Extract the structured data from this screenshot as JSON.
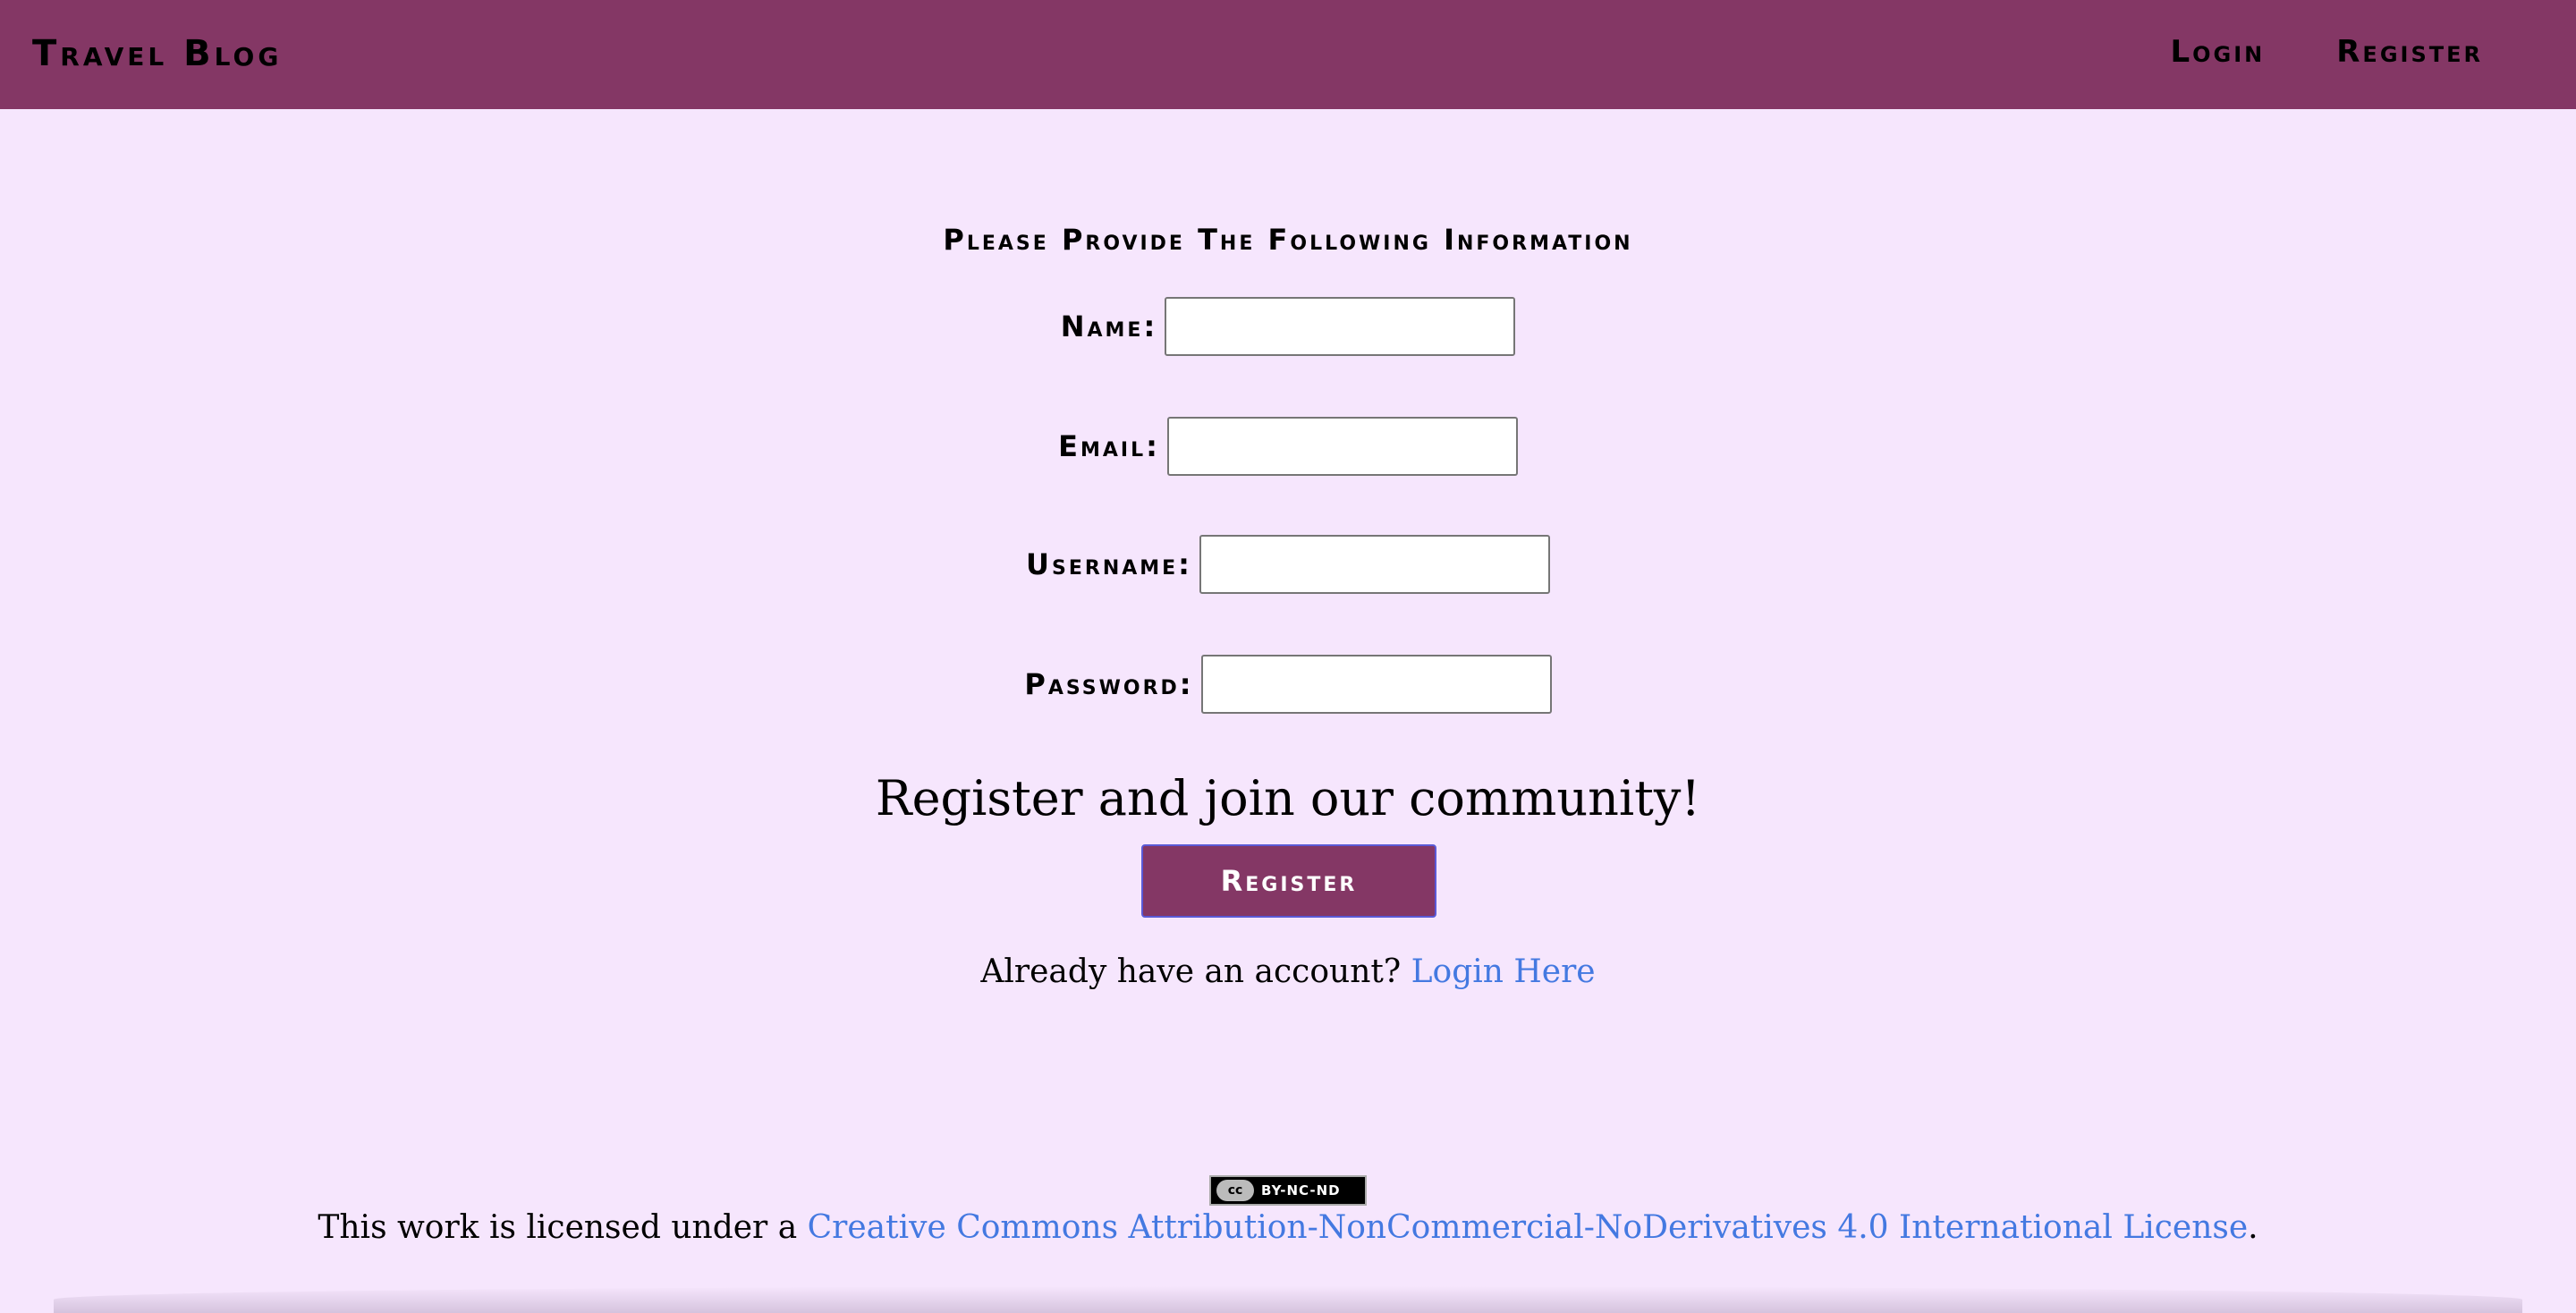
{
  "navbar": {
    "brand": "Travel Blog",
    "links": [
      {
        "label": "Login"
      },
      {
        "label": "Register"
      }
    ],
    "color": "#843765"
  },
  "form": {
    "heading": "Please Provide The Following Information",
    "fields": [
      {
        "label": "Name:",
        "value": ""
      },
      {
        "label": "Email:",
        "value": ""
      },
      {
        "label": "Username:",
        "value": ""
      },
      {
        "label": "Password:",
        "value": ""
      }
    ],
    "tagline": "Register and join our community!",
    "submit_label": "Register",
    "login_prompt": "Already have an account?",
    "login_link": "Login Here"
  },
  "footer": {
    "badge_icon": "cc-license-icon",
    "badge_cc": "cc",
    "badge_text": "BY-NC-ND",
    "license_prefix": "This work is licensed under a",
    "license_link": "Creative Commons Attribution-NonCommercial-NoDerivatives 4.0 International License",
    "license_suffix": "."
  },
  "colors": {
    "background": "#f6e6fd",
    "accent": "#843765",
    "link": "#4479e1"
  }
}
